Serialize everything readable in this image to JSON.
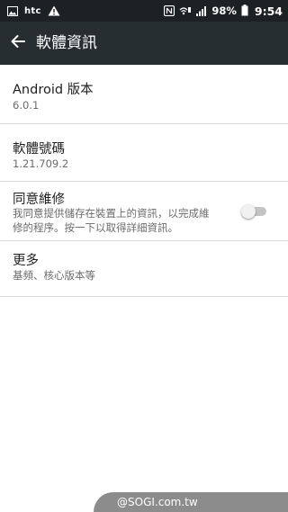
{
  "status_bar": {
    "brand": "htc",
    "battery_percent": "98%",
    "time": "9:54"
  },
  "toolbar": {
    "title": "軟體資訊",
    "back_icon": "arrow-left-icon"
  },
  "items": [
    {
      "title": "Android 版本",
      "subtitle": "6.0.1"
    },
    {
      "title": "軟體號碼",
      "subtitle": "1.21.709.2"
    },
    {
      "title": "同意維修",
      "subtitle_line1": "我同意提供儲存在裝置上的資訊，以完成維",
      "subtitle_line2": "修的程序。按一下以取得詳細資訊。",
      "toggle_on": false
    },
    {
      "title": "更多",
      "subtitle": "基頻、核心版本等"
    }
  ],
  "watermark": "@SOGI.com.tw",
  "colors": {
    "status_bar": "#1c2124",
    "toolbar": "#272e31",
    "divider": "#d9d9d9",
    "toggle_off_track": "#c4c4c4"
  }
}
